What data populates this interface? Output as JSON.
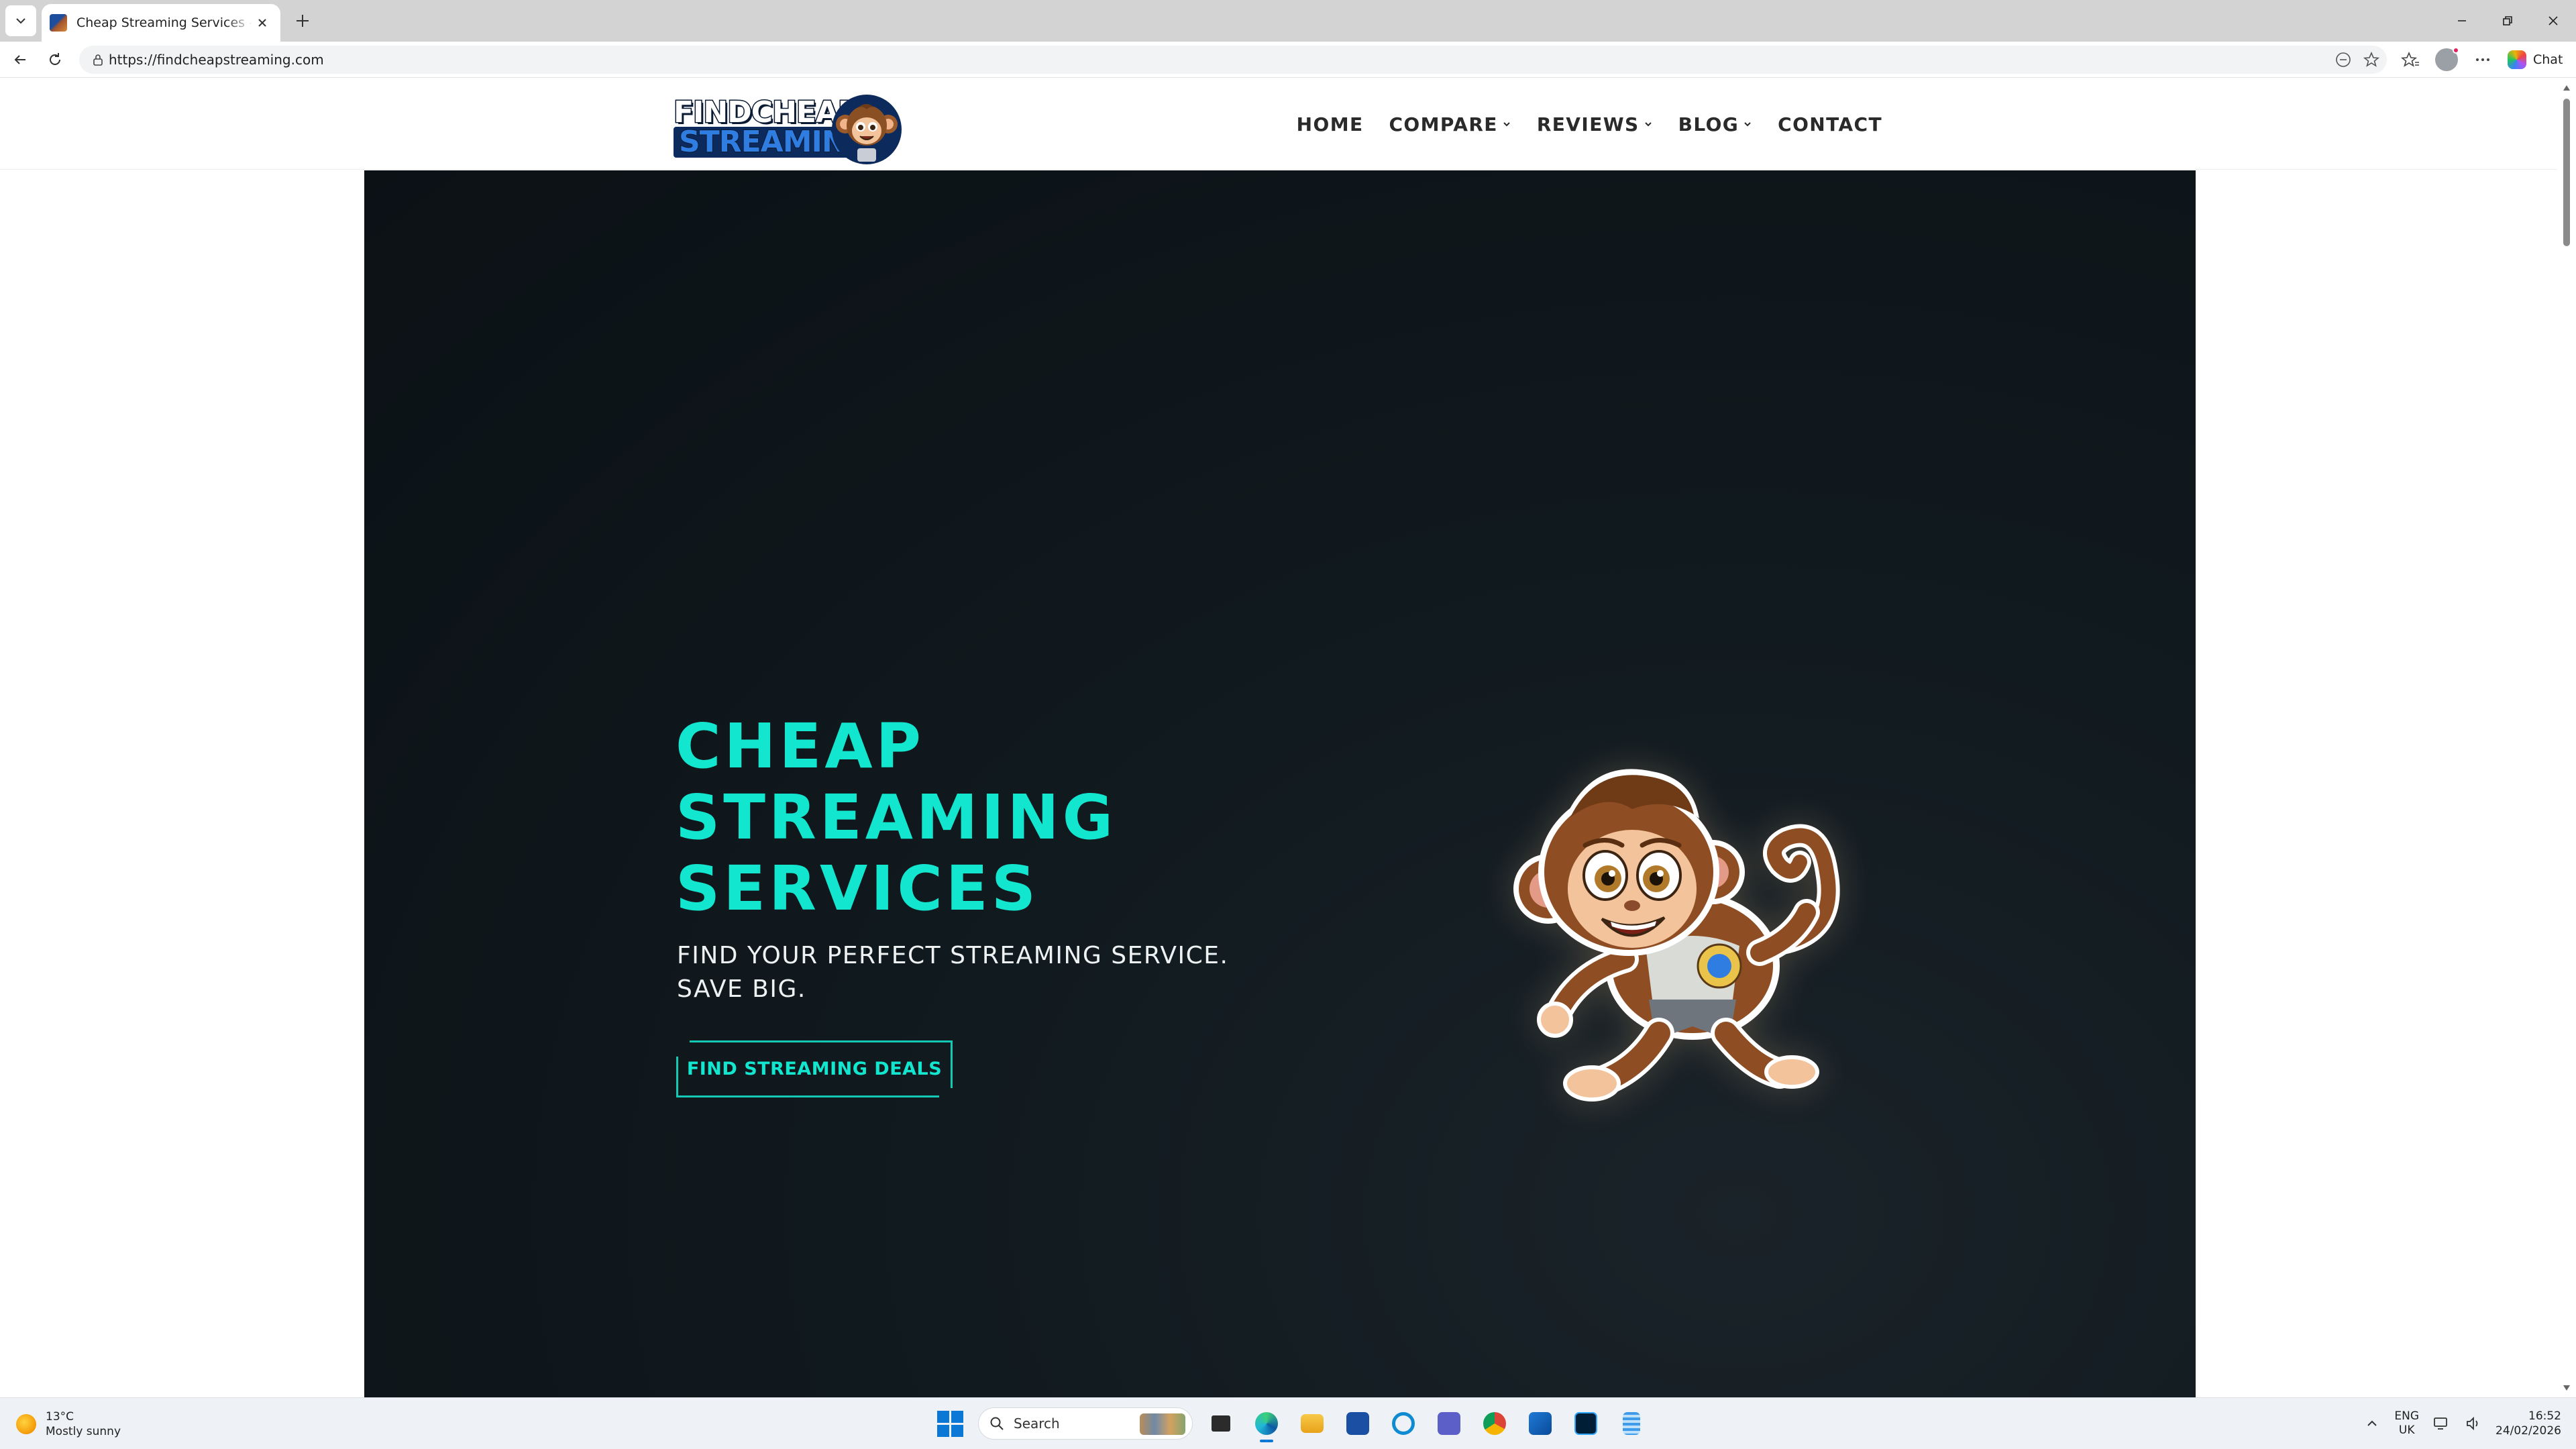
{
  "browser": {
    "tab": {
      "title": "Cheap Streaming Services - Best Streaming"
    },
    "address": {
      "url": "https://findcheapstreaming.com"
    },
    "chat_label": "Chat"
  },
  "site": {
    "logo": {
      "line1": "FINDCHEAP",
      "line2": "STREAMING"
    },
    "nav": [
      {
        "label": "HOME",
        "has_dropdown": false
      },
      {
        "label": "COMPARE",
        "has_dropdown": true
      },
      {
        "label": "REVIEWS",
        "has_dropdown": true
      },
      {
        "label": "BLOG",
        "has_dropdown": true
      },
      {
        "label": "CONTACT",
        "has_dropdown": false
      }
    ],
    "hero": {
      "title_lines": [
        "CHEAP",
        "STREAMING",
        "SERVICES"
      ],
      "subtitle": "FIND YOUR PERFECT STREAMING SERVICE. SAVE BIG.",
      "cta_label": "FIND STREAMING DEALS"
    }
  },
  "taskbar": {
    "weather": {
      "temp": "13°C",
      "condition": "Mostly sunny"
    },
    "search_placeholder": "Search",
    "tray": {
      "lang": "ENG",
      "region": "UK",
      "time": "16:52",
      "date": "24/02/2026"
    }
  },
  "colors": {
    "accent": "#13e6cf",
    "hero_bg": "#0b1115",
    "logo_blue": "#2f7de1"
  }
}
